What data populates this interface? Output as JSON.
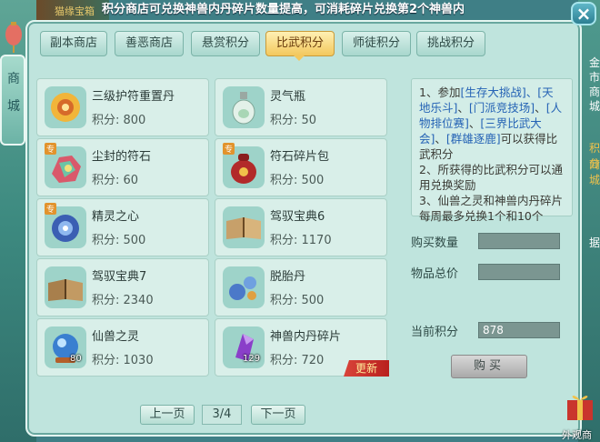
{
  "top_bar": {
    "left_text": "猫缘宝箱",
    "marquee": "积分商店可兑换神兽内丹碎片数量提高，可消耗碎片兑换第2个神兽内"
  },
  "close_label": "×",
  "side_ribbon": {
    "label": "商城"
  },
  "tabs": [
    {
      "label": "副本商店",
      "active": false
    },
    {
      "label": "善恶商店",
      "active": false
    },
    {
      "label": "悬赏积分",
      "active": false
    },
    {
      "label": "比武积分",
      "active": true
    },
    {
      "label": "师徒积分",
      "active": false
    },
    {
      "label": "挑战积分",
      "active": false
    }
  ],
  "items": [
    {
      "name": "三级护符重置丹",
      "price": "积分: 800",
      "icon": "golden-amulet-icon",
      "badge": "",
      "count": ""
    },
    {
      "name": "灵气瓶",
      "price": "积分: 50",
      "icon": "spirit-bottle-icon",
      "badge": "",
      "count": ""
    },
    {
      "name": "尘封的符石",
      "price": "积分: 60",
      "icon": "rune-stone-icon",
      "badge": "专",
      "count": ""
    },
    {
      "name": "符石碎片包",
      "price": "积分: 500",
      "icon": "red-pouch-icon",
      "badge": "专",
      "count": ""
    },
    {
      "name": "精灵之心",
      "price": "积分: 500",
      "icon": "spirit-heart-icon",
      "badge": "专",
      "count": ""
    },
    {
      "name": "驾驭宝典6",
      "price": "积分: 1170",
      "icon": "open-book-icon",
      "badge": "",
      "count": ""
    },
    {
      "name": "驾驭宝典7",
      "price": "积分: 2340",
      "icon": "open-book-icon",
      "badge": "",
      "count": ""
    },
    {
      "name": "脱胎丹",
      "price": "积分: 500",
      "icon": "blue-pill-icon",
      "badge": "",
      "count": ""
    },
    {
      "name": "仙兽之灵",
      "price": "积分: 1030",
      "icon": "blue-orb-icon",
      "badge": "",
      "count": "80"
    },
    {
      "name": "神兽内丹碎片",
      "price": "积分: 720",
      "icon": "purple-crystal-icon",
      "badge": "",
      "count": "129"
    }
  ],
  "new_badge": "更新",
  "pager": {
    "prev": "上一页",
    "page": "3/4",
    "next": "下一页"
  },
  "rules": {
    "l1a": "1、参加",
    "l1b": "[生存大挑战]",
    "l1c": "、[",
    "l1d": "天地乐斗]",
    "l1e": "、",
    "l1f": "[门派竞技场]",
    "l1g": "、",
    "l1h": "[人物排位赛]",
    "l1i": "、",
    "l1j": "[三界比武大会]",
    "l1k": "、",
    "l1l": "[群雄逐鹿]",
    "l1m": "可以获得比武积分",
    "l2": "2、所获得的比武积分可以通用兑换奖励",
    "l3": "3、仙兽之灵和神兽内丹碎片每周最多兑换1个和10个"
  },
  "form": {
    "qty_label": "购买数量",
    "total_label": "物品总价",
    "current_label": "当前积分",
    "qty_value": "",
    "total_value": "",
    "current_value": "878"
  },
  "buy_button": "购买",
  "right_edge": {
    "t1": "金",
    "t2": "市",
    "t3": "商",
    "t4": "城",
    "t5": "积分",
    "t6": "商城",
    "t7": "据"
  },
  "gift_label": "外观商"
}
